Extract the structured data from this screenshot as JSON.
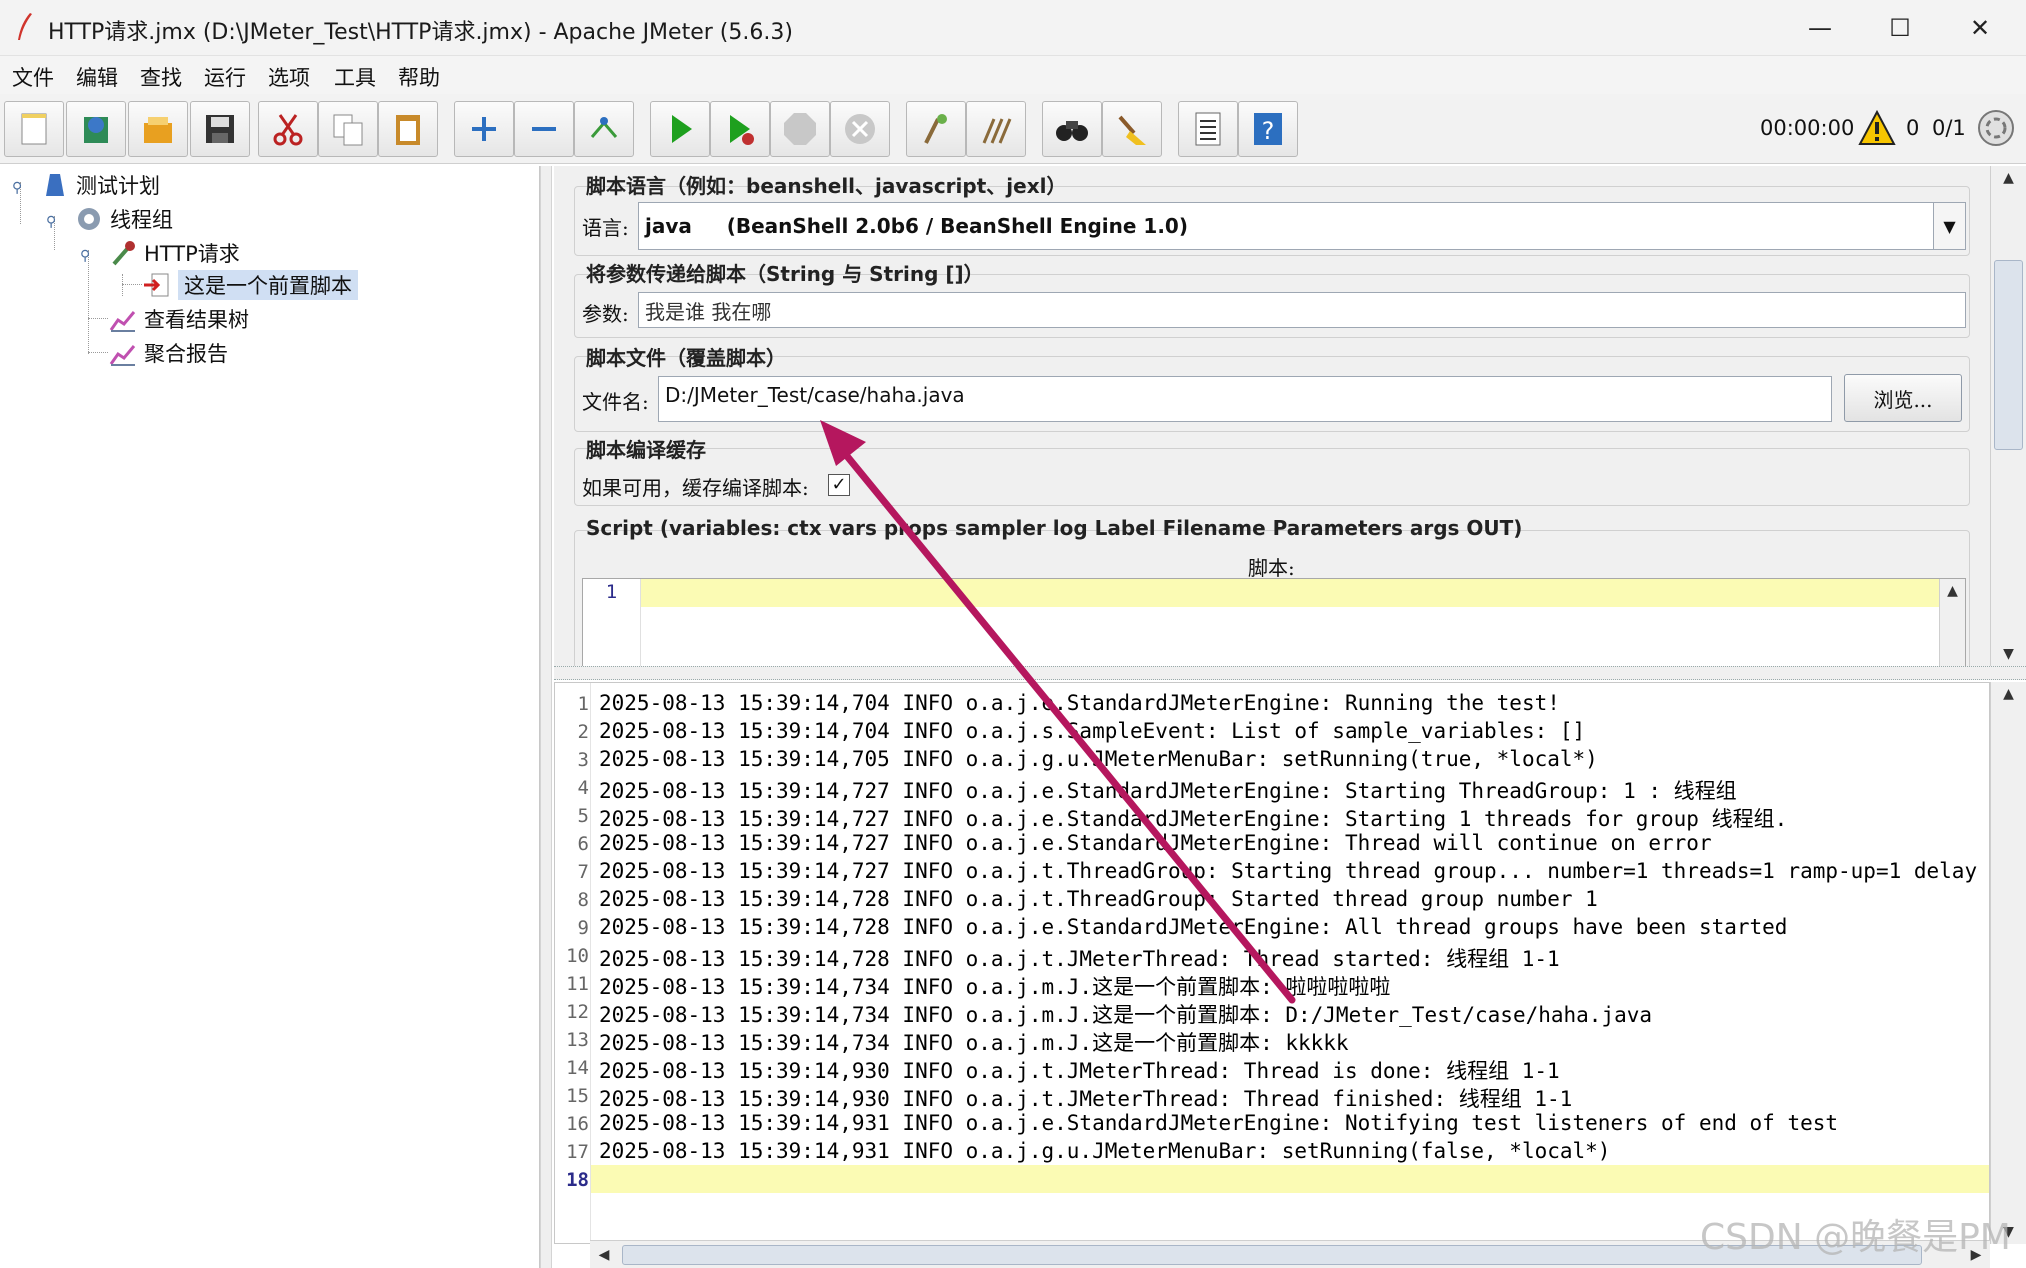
{
  "window": {
    "title": "HTTP请求.jmx (D:\\JMeter_Test\\HTTP请求.jmx) - Apache JMeter (5.6.3)",
    "minimize": "—",
    "maximize": "☐",
    "close": "✕"
  },
  "menu": [
    "文件",
    "编辑",
    "查找",
    "运行",
    "选项",
    "工具",
    "帮助"
  ],
  "toolbar": {
    "buttons": [
      "new-icon",
      "templates-icon",
      "open-icon",
      "save-icon",
      "cut-icon",
      "copy-icon",
      "paste-icon",
      "expand-icon",
      "collapse-icon",
      "toggle-icon",
      "start-icon",
      "start-no-pause-icon",
      "stop-icon",
      "shutdown-icon",
      "clear-icon",
      "clear-all-icon",
      "search-icon",
      "reset-search-icon",
      "function-helper-icon",
      "help-icon"
    ],
    "timer": "00:00:00",
    "warnings": "0",
    "threads": "0/1"
  },
  "tree": {
    "test_plan": "测试计划",
    "thread_group": "线程组",
    "http_request": "HTTP请求",
    "preprocessor": "这是一个前置脚本",
    "results_tree": "查看结果树",
    "aggregate_report": "聚合报告"
  },
  "editor": {
    "lang_group_title": "脚本语言（例如：beanshell、javascript、jexl）",
    "lang_label": "语言:",
    "lang_value": "java     (BeanShell 2.0b6 / BeanShell Engine 1.0)",
    "params_group_title": "将参数传递给脚本（String 与 String []）",
    "params_label": "参数:",
    "params_value": "我是谁 我在哪",
    "file_group_title": "脚本文件（覆盖脚本）",
    "file_label": "文件名:",
    "file_value": "D:/JMeter_Test/case/haha.java",
    "browse_label": "浏览...",
    "cache_group_title": "脚本编译缓存",
    "cache_label": "如果可用，缓存编译脚本:",
    "cache_checked": "✓",
    "script_group_title": "Script (variables: ctx vars props sampler log Label Filename Parameters args OUT)",
    "script_label": "脚本:",
    "script_line_number": "1"
  },
  "log": {
    "lines": [
      "2025-08-13 15:39:14,704 INFO o.a.j.e.StandardJMeterEngine: Running the test!",
      "2025-08-13 15:39:14,704 INFO o.a.j.s.SampleEvent: List of sample_variables: []",
      "2025-08-13 15:39:14,705 INFO o.a.j.g.u.JMeterMenuBar: setRunning(true, *local*)",
      "2025-08-13 15:39:14,727 INFO o.a.j.e.StandardJMeterEngine: Starting ThreadGroup: 1 : 线程组",
      "2025-08-13 15:39:14,727 INFO o.a.j.e.StandardJMeterEngine: Starting 1 threads for group 线程组.",
      "2025-08-13 15:39:14,727 INFO o.a.j.e.StandardJMeterEngine: Thread will continue on error",
      "2025-08-13 15:39:14,727 INFO o.a.j.t.ThreadGroup: Starting thread group... number=1 threads=1 ramp-up=1 delay",
      "2025-08-13 15:39:14,728 INFO o.a.j.t.ThreadGroup: Started thread group number 1",
      "2025-08-13 15:39:14,728 INFO o.a.j.e.StandardJMeterEngine: All thread groups have been started",
      "2025-08-13 15:39:14,728 INFO o.a.j.t.JMeterThread: Thread started: 线程组 1-1",
      "2025-08-13 15:39:14,734 INFO o.a.j.m.J.这是一个前置脚本: 啦啦啦啦啦",
      "2025-08-13 15:39:14,734 INFO o.a.j.m.J.这是一个前置脚本: D:/JMeter_Test/case/haha.java",
      "2025-08-13 15:39:14,734 INFO o.a.j.m.J.这是一个前置脚本: kkkkk",
      "2025-08-13 15:39:14,930 INFO o.a.j.t.JMeterThread: Thread is done: 线程组 1-1",
      "2025-08-13 15:39:14,930 INFO o.a.j.t.JMeterThread: Thread finished: 线程组 1-1",
      "2025-08-13 15:39:14,931 INFO o.a.j.e.StandardJMeterEngine: Notifying test listeners of end of test",
      "2025-08-13 15:39:14,931 INFO o.a.j.g.u.JMeterMenuBar: setRunning(false, *local*)",
      ""
    ],
    "current_line": "18"
  },
  "watermark": "CSDN @晚餐是PM",
  "colors": {
    "annotation_arrow": "#b5175e",
    "highlight": "#fbfbb4",
    "selection": "#d0dff3"
  }
}
